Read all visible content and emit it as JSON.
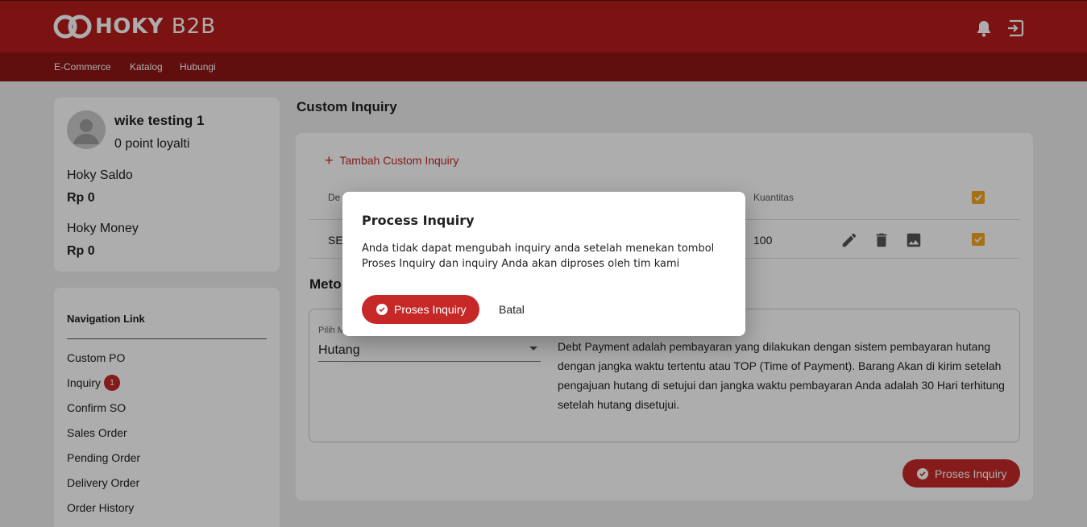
{
  "header": {
    "brand": "HOKY",
    "brand_sub": "B2B",
    "icons": [
      "bell-icon",
      "logout-icon"
    ]
  },
  "subnav": [
    "E-Commerce",
    "Katalog",
    "Hubungi"
  ],
  "profile": {
    "name": "wike testing 1",
    "points": "0 point loyalti",
    "saldo_label": "Hoky Saldo",
    "saldo_value": "Rp 0",
    "money_label": "Hoky Money",
    "money_value": "Rp 0"
  },
  "navigation": {
    "title": "Navigation Link",
    "items": [
      "Custom PO",
      "Inquiry",
      "Confirm SO",
      "Sales Order",
      "Pending Order",
      "Delivery Order",
      "Order History"
    ],
    "inquiry_badge": "1"
  },
  "page": {
    "title": "Custom Inquiry",
    "add_link": "Tambah Custom Inquiry",
    "table": {
      "col_desc": "De",
      "col_qty": "Kuantitas",
      "row_desc": "SE",
      "row_qty": "100"
    },
    "method_title": "Meto",
    "select_label": "Pilih M",
    "select_value": "Hutang",
    "payment_desc": "Debt Payment adalah pembayaran yang dilakukan dengan sistem pembayaran hutang dengan jangka waktu tertentu atau TOP (Time of Payment). Barang Akan di kirim setelah pengajuan hutang di setujui dan jangka waktu pembayaran Anda adalah 30 Hari terhitung setelah hutang disetujui.",
    "submit_label": "Proses Inquiry"
  },
  "dialog": {
    "title": "Process Inquiry",
    "text": "Anda tidak dapat mengubah inquiry anda setelah menekan tombol Proses Inquiry dan inquiry Anda akan diproses oleh tim kami",
    "confirm_label": "Proses Inquiry",
    "cancel_label": "Batal"
  },
  "colors": {
    "primary": "#b71c1c",
    "primary_dark": "#8e1616",
    "accent_checkbox": "#f5a623"
  }
}
